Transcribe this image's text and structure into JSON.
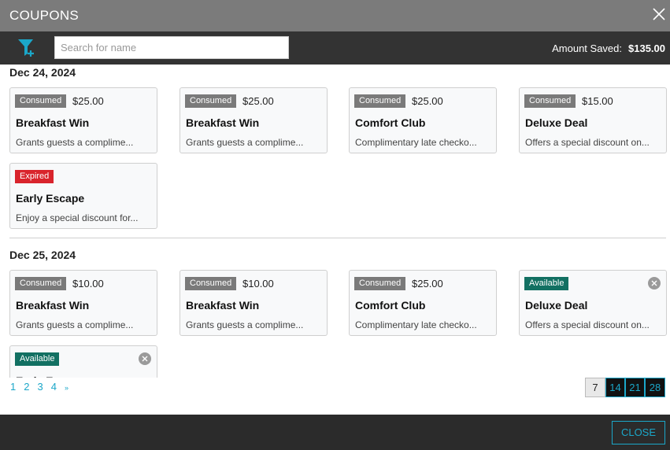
{
  "header": {
    "title": "COUPONS"
  },
  "toolbar": {
    "search_placeholder": "Search for name",
    "amount_label": "Amount Saved:",
    "amount_value": "$135.00"
  },
  "groups": [
    {
      "date": "Dec 24, 2024",
      "coupons": [
        {
          "status": "Consumed",
          "price": "$25.00",
          "name": "Breakfast Win",
          "desc": "Grants guests a complime..."
        },
        {
          "status": "Consumed",
          "price": "$25.00",
          "name": "Breakfast Win",
          "desc": "Grants guests a complime..."
        },
        {
          "status": "Consumed",
          "price": "$25.00",
          "name": "Comfort Club",
          "desc": "Complimentary late checko..."
        },
        {
          "status": "Consumed",
          "price": "$15.00",
          "name": "Deluxe Deal",
          "desc": "Offers a special discount on..."
        },
        {
          "status": "Expired",
          "price": "",
          "name": "Early Escape",
          "desc": "Enjoy a special discount for..."
        }
      ]
    },
    {
      "date": "Dec 25, 2024",
      "coupons": [
        {
          "status": "Consumed",
          "price": "$10.00",
          "name": "Breakfast Win",
          "desc": "Grants guests a complime..."
        },
        {
          "status": "Consumed",
          "price": "$10.00",
          "name": "Breakfast Win",
          "desc": "Grants guests a complime..."
        },
        {
          "status": "Consumed",
          "price": "$25.00",
          "name": "Comfort Club",
          "desc": "Complimentary late checko..."
        },
        {
          "status": "Available",
          "price": "",
          "name": "Deluxe Deal",
          "desc": "Offers a special discount on..."
        },
        {
          "status": "Available",
          "price": "",
          "name": "Early Escape",
          "desc": ""
        }
      ]
    }
  ],
  "pagination": {
    "pages": [
      "1",
      "2",
      "3",
      "4"
    ],
    "more": "»"
  },
  "page_sizes": [
    "7",
    "14",
    "21",
    "28"
  ],
  "footer": {
    "close_label": "CLOSE"
  },
  "colors": {
    "accent": "#1ba7c9",
    "consumed": "#7a7a7a",
    "expired": "#d9242c",
    "available": "#127062"
  }
}
